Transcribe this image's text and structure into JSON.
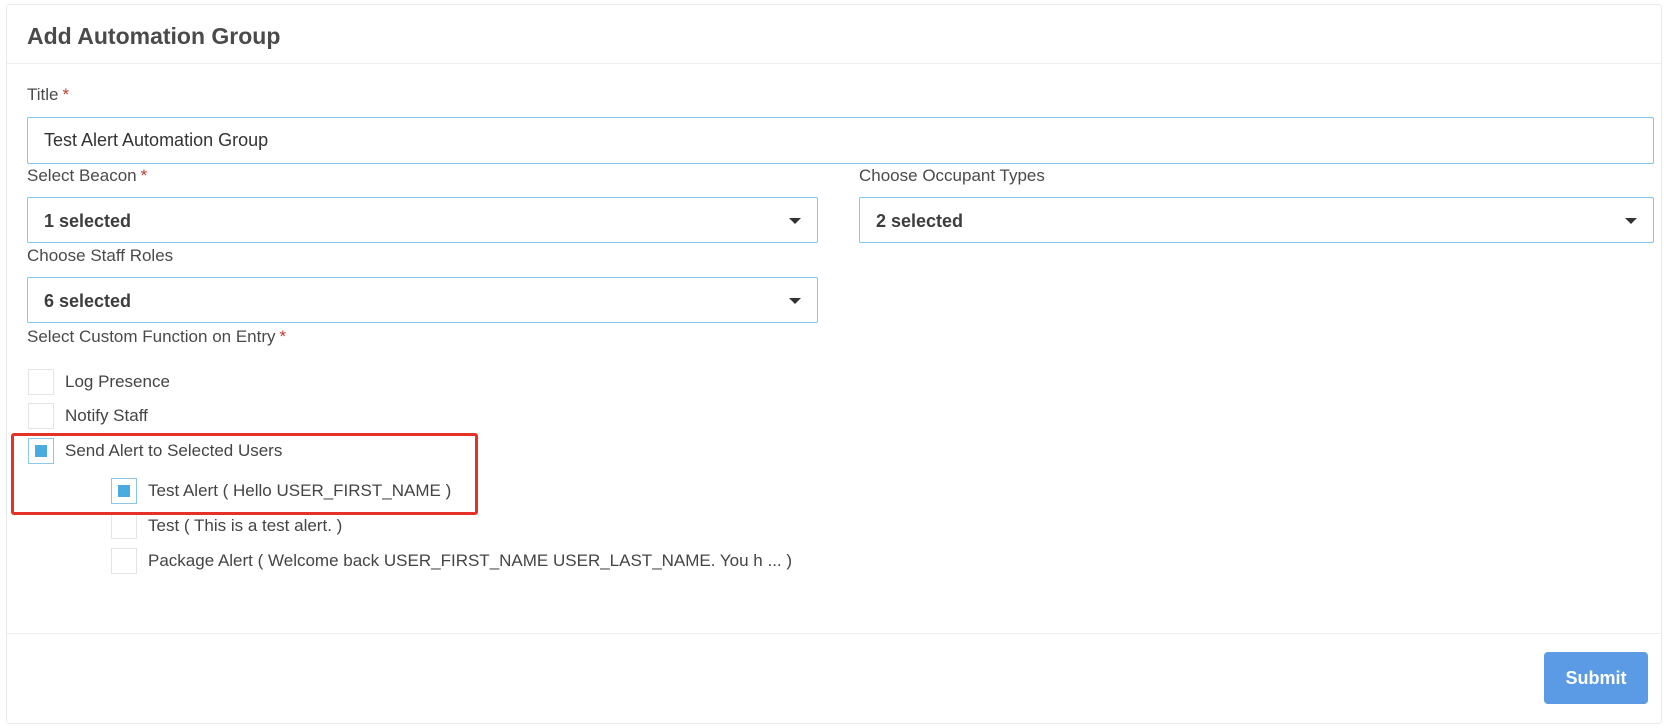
{
  "header": {
    "title": "Add Automation Group"
  },
  "form": {
    "title_field": {
      "label": "Title",
      "required_mark": "*",
      "value": "Test Alert Automation Group"
    },
    "beacon": {
      "label": "Select Beacon",
      "required_mark": "*",
      "value": "1 selected"
    },
    "occupant_types": {
      "label": "Choose Occupant Types",
      "value": "2 selected"
    },
    "staff_roles": {
      "label": "Choose Staff Roles",
      "value": "6 selected"
    },
    "custom_function": {
      "label": "Select Custom Function on Entry",
      "required_mark": "*",
      "options": [
        {
          "label": "Log Presence",
          "checked": false
        },
        {
          "label": "Notify Staff",
          "checked": false
        },
        {
          "label": "Send Alert to Selected Users",
          "checked": true
        }
      ],
      "alerts": [
        {
          "label": "Test Alert ( Hello USER_FIRST_NAME )",
          "checked": true
        },
        {
          "label": "Test ( This is a test alert. )",
          "checked": false
        },
        {
          "label": "Package Alert ( Welcome back USER_FIRST_NAME USER_LAST_NAME. You h ... )",
          "checked": false
        }
      ]
    }
  },
  "footer": {
    "submit_label": "Submit"
  },
  "colors": {
    "accent": "#4aabe0",
    "input_border": "#7ec8e8",
    "button": "#5b9be6",
    "highlight": "#e53228",
    "required": "#c0392b"
  }
}
